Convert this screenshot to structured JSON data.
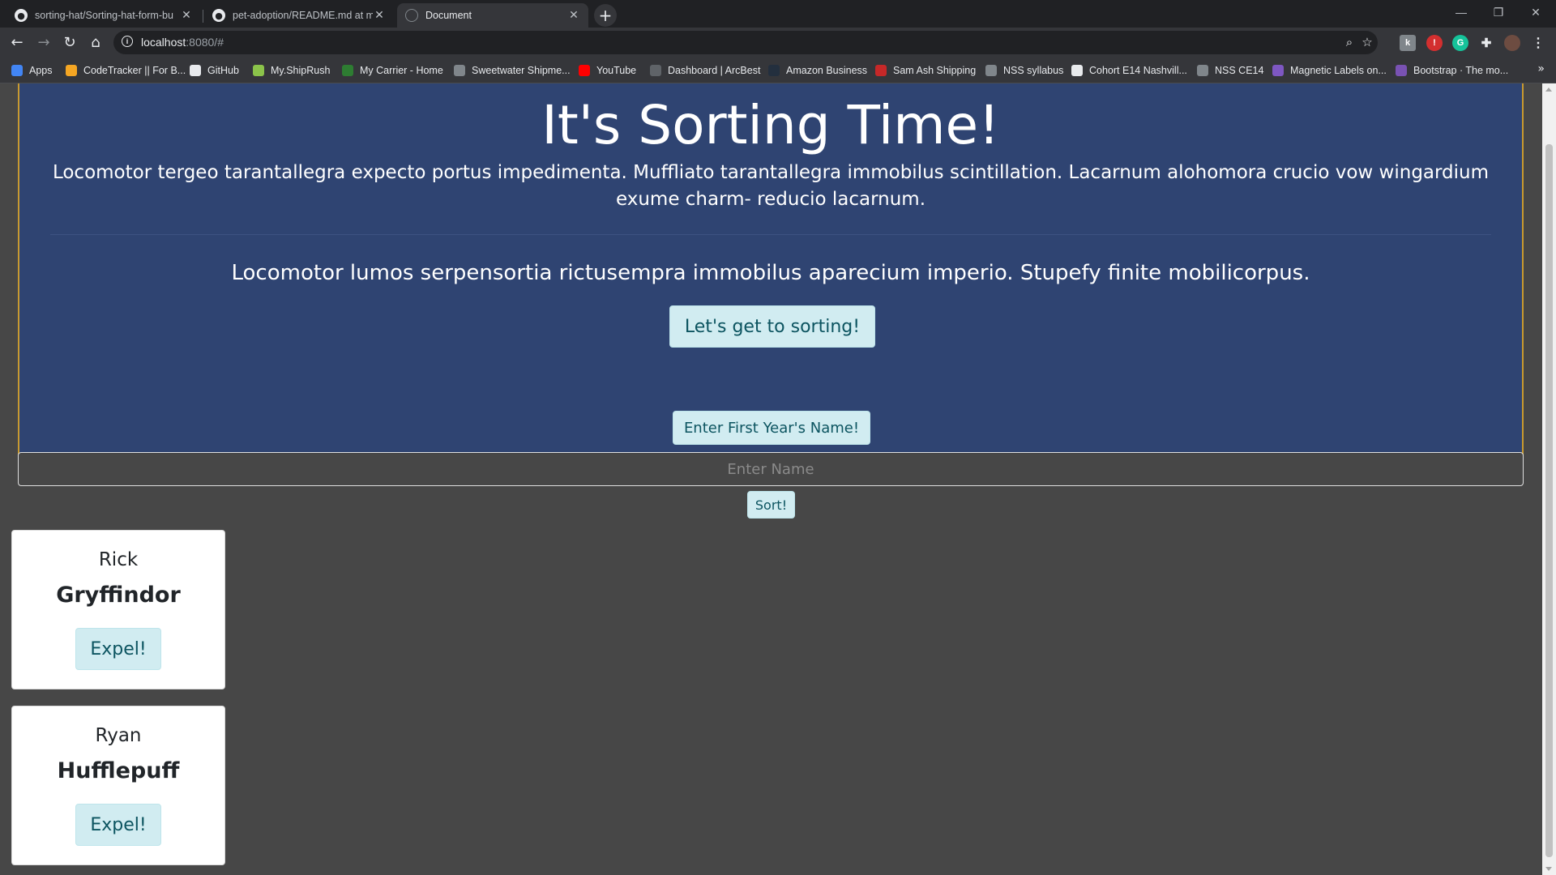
{
  "browser": {
    "tabs": [
      {
        "title": "sorting-hat/Sorting-hat-form-bu",
        "favicon": "github-icon",
        "active": false
      },
      {
        "title": "pet-adoption/README.md at ma",
        "favicon": "github-icon",
        "active": false
      },
      {
        "title": "Document",
        "favicon": "globe-icon",
        "active": true
      }
    ],
    "url_host": "localhost",
    "url_path": ":8080/#",
    "bookmarks": [
      {
        "label": "Apps",
        "icon": "apps-grid-icon",
        "color": "#4285f4"
      },
      {
        "label": "CodeTracker || For B...",
        "icon": "codetracker-icon",
        "color": "#f5a623"
      },
      {
        "label": "GitHub",
        "icon": "github-icon",
        "color": "#e8eaed"
      },
      {
        "label": "My.ShipRush",
        "icon": "shiprush-icon",
        "color": "#8bc34a"
      },
      {
        "label": "My Carrier - Home",
        "icon": "carrier-icon",
        "color": "#2e7d32"
      },
      {
        "label": "Sweetwater Shipme...",
        "icon": "globe-icon",
        "color": "#80868b"
      },
      {
        "label": "YouTube",
        "icon": "youtube-icon",
        "color": "#ff0000"
      },
      {
        "label": "Dashboard | ArcBest",
        "icon": "arcbest-icon",
        "color": "#5f6368"
      },
      {
        "label": "Amazon Business",
        "icon": "amazon-icon",
        "color": "#232f3e"
      },
      {
        "label": "Sam Ash Shipping",
        "icon": "samash-icon",
        "color": "#c62828"
      },
      {
        "label": "NSS syllabus",
        "icon": "globe-icon",
        "color": "#80868b"
      },
      {
        "label": "Cohort E14 Nashvill...",
        "icon": "cohort-icon",
        "color": "#e8eaed"
      },
      {
        "label": "NSS CE14",
        "icon": "globe-icon",
        "color": "#80868b"
      },
      {
        "label": "Magnetic Labels on...",
        "icon": "magnetic-icon",
        "color": "#7e57c2"
      },
      {
        "label": "Bootstrap · The mo...",
        "icon": "bootstrap-icon",
        "color": "#7952b3"
      }
    ]
  },
  "jumbotron": {
    "title": "It's Sorting Time!",
    "lead": "Locomotor tergeo tarantallegra expecto portus impedimenta. Muffliato tarantallegra immobilus scintillation. Lacarnum alohomora crucio vow wingardium exume charm- reducio lacarnum.",
    "sublead": "Locomotor lumos serpensortia rictusempra immobilus aparecium imperio. Stupefy finite mobilicorpus.",
    "button_label": "Let's get to sorting!"
  },
  "form": {
    "label_button": "Enter First Year's Name!",
    "input_value": "",
    "input_placeholder": "Enter Name",
    "sort_button": "Sort!"
  },
  "students": [
    {
      "name": "Rick",
      "house": "Gryffindor",
      "expel_label": "Expel!"
    },
    {
      "name": "Ryan",
      "house": "Hufflepuff",
      "expel_label": "Expel!"
    }
  ]
}
